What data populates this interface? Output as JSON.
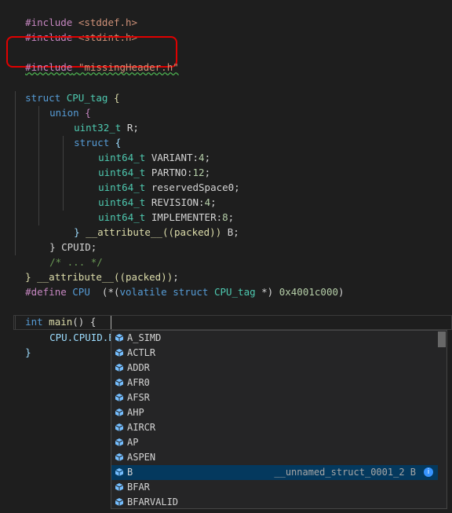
{
  "code": {
    "l1": {
      "dir": "#include",
      "arg": "<stddef.h>"
    },
    "l2": {
      "dir": "#include",
      "arg": "<stdint.h>"
    },
    "l3": {
      "dir": "#include",
      "arg": "\"missingHeader.h\""
    },
    "l4": {
      "kw": "struct",
      "name": "CPU_tag",
      "brace": "{"
    },
    "l5": {
      "kw": "union",
      "brace": "{"
    },
    "l6": {
      "ty": "uint32_t",
      "rest": "R;"
    },
    "l7": {
      "kw": "struct",
      "brace": "{"
    },
    "fields": [
      {
        "ty": "uint64_t",
        "name": "VARIANT",
        "sep": ":",
        "num": "4",
        "end": ";"
      },
      {
        "ty": "uint64_t",
        "name": "PARTNO",
        "sep": ":",
        "num": "12",
        "end": ";"
      },
      {
        "ty": "uint64_t",
        "name": "reservedSpace0",
        "sep": "",
        "num": "",
        "end": ";"
      },
      {
        "ty": "uint64_t",
        "name": "REVISION",
        "sep": ":",
        "num": "4",
        "end": ";"
      },
      {
        "ty": "uint64_t",
        "name": "IMPLEMENTER",
        "sep": ":",
        "num": "8",
        "end": ";"
      }
    ],
    "l13": {
      "pre": "} ",
      "attr": "__attribute__",
      "args": "((packed))",
      "post": " B;"
    },
    "l14": {
      "text": "} CPUID;"
    },
    "l15": {
      "comment": "/* ... */"
    },
    "l16": {
      "pre": "} ",
      "attr": "__attribute__",
      "args": "((packed))",
      "post": ";"
    },
    "l17": {
      "dir": "#define",
      "name": "CPU",
      "open": "(*(",
      "kw1": "volatile",
      "kw2": "struct",
      "ty": "CPU_tag",
      "mid": " *) ",
      "addr": "0x4001c000",
      "close": ")"
    },
    "l18": {
      "kw": "int",
      "fn": "main",
      "rest": "() {"
    },
    "l19": {
      "text": "CPU.CPUID.B."
    },
    "l20": {
      "text": "}"
    }
  },
  "suggestions": {
    "items": [
      {
        "label": "A_SIMD",
        "detail": ""
      },
      {
        "label": "ACTLR",
        "detail": ""
      },
      {
        "label": "ADDR",
        "detail": ""
      },
      {
        "label": "AFR0",
        "detail": ""
      },
      {
        "label": "AFSR",
        "detail": ""
      },
      {
        "label": "AHP",
        "detail": ""
      },
      {
        "label": "AIRCR",
        "detail": ""
      },
      {
        "label": "AP",
        "detail": ""
      },
      {
        "label": "ASPEN",
        "detail": ""
      },
      {
        "label": "B",
        "detail": "__unnamed_struct_0001_2 B"
      },
      {
        "label": "BFAR",
        "detail": ""
      },
      {
        "label": "BFARVALID",
        "detail": ""
      }
    ],
    "selected_index": 9,
    "item_icon": "field-cube-icon",
    "info_icon": "info-icon"
  },
  "colors": {
    "highlight_box": "#e00000",
    "selection": "#04395e",
    "squiggle": "#4caf50"
  }
}
